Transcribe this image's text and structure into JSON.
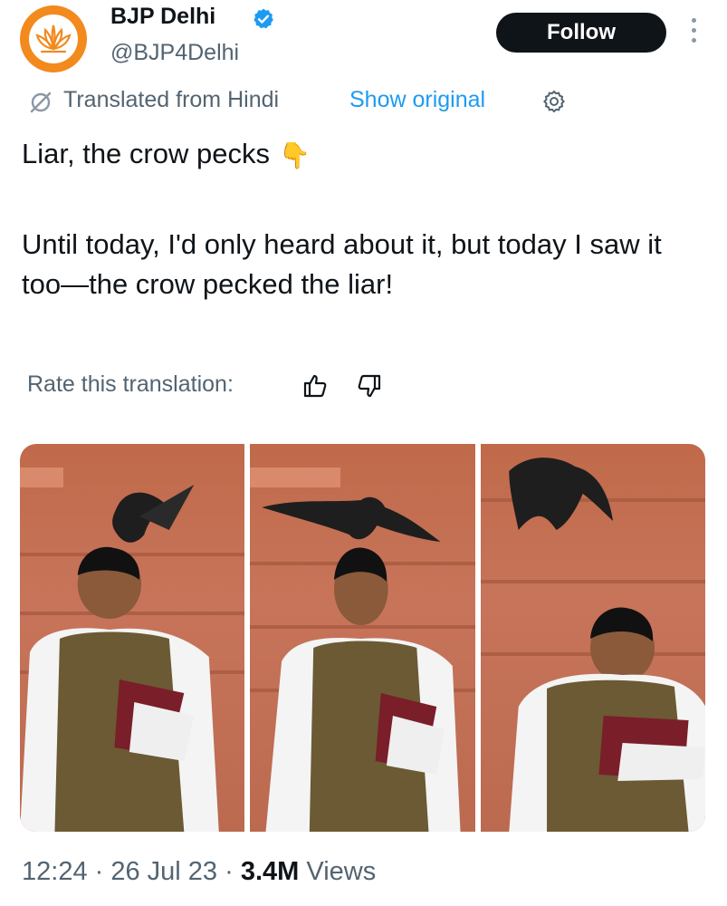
{
  "author": {
    "name": "BJP Delhi",
    "handle": "@BJP4Delhi",
    "verified": true,
    "avatar_colors": {
      "ring": "#f28a1e",
      "lotus": "#f28a1e",
      "inner": "#ffffff"
    }
  },
  "actions": {
    "follow_label": "Follow",
    "more_icon": "more-vertical-icon"
  },
  "translation": {
    "icon": "translate-off-icon",
    "text": "Translated from Hindi",
    "show_original": "Show original",
    "settings_icon": "gear-icon"
  },
  "tweet": {
    "line1": "Liar, the crow pecks",
    "emoji": "👇",
    "paragraph2": "Until today, I'd only heard about it, but today I saw it too—the crow pecked the liar!"
  },
  "rate": {
    "label": "Rate this translation:",
    "up_icon": "thumbs-up-icon",
    "down_icon": "thumbs-down-icon"
  },
  "media": {
    "panels": [
      {
        "description": "photo-1"
      },
      {
        "description": "photo-2"
      },
      {
        "description": "photo-3"
      }
    ]
  },
  "footer": {
    "time": "12:24",
    "date": "26 Jul 23",
    "views_count": "3.4M",
    "views_label": "Views"
  },
  "colors": {
    "accent": "#1d9bf0",
    "text": "#0f1419",
    "muted": "#536471",
    "follow_bg": "#0f1419"
  }
}
